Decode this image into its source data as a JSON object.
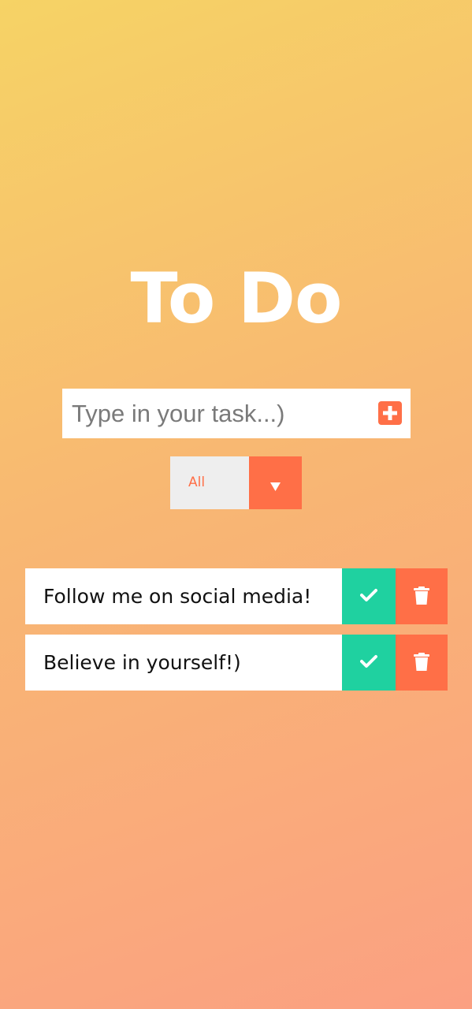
{
  "app": {
    "title": "To Do"
  },
  "task_form": {
    "placeholder": "Type in your task...)",
    "value": "",
    "add_icon": "plus-square-icon"
  },
  "filter": {
    "selected": "All",
    "arrow_icon": "triangle-down-icon"
  },
  "todos": [
    {
      "text": "Follow me on social media!",
      "complete_icon": "check-icon",
      "delete_icon": "trash-icon"
    },
    {
      "text": "Believe in yourself!)",
      "complete_icon": "check-icon",
      "delete_icon": "trash-icon"
    }
  ],
  "colors": {
    "gradient_start": "#f6d365",
    "gradient_end": "#fba082",
    "accent": "#ff6f47",
    "complete": "#1fd1a0",
    "surface": "#ffffff",
    "filter_bg": "#eeeeee"
  }
}
